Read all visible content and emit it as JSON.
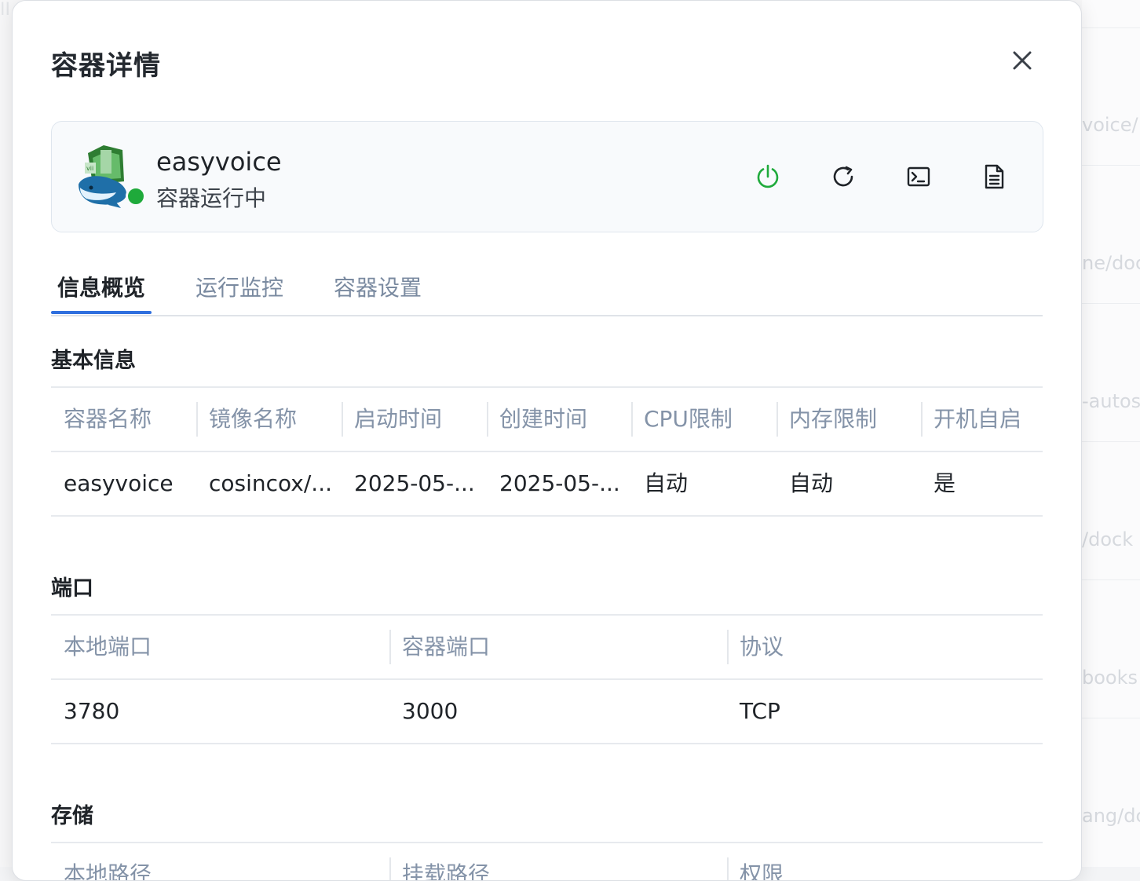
{
  "background": {
    "fragments": [
      "voice/",
      "ne/doc",
      "-autos",
      "/dock",
      "books",
      "ang/dc"
    ],
    "corner_text": "II"
  },
  "modal": {
    "title": "容器详情",
    "close_icon": "close-icon"
  },
  "container": {
    "name": "easyvoice",
    "status": "容器运行中",
    "status_color": "#1faa3b",
    "actions": [
      {
        "name": "power-icon",
        "color": "#1faa3b"
      },
      {
        "name": "restart-icon",
        "color": "#1f2328"
      },
      {
        "name": "terminal-icon",
        "color": "#1f2328"
      },
      {
        "name": "log-icon",
        "color": "#1f2328"
      }
    ]
  },
  "tabs": [
    {
      "label": "信息概览",
      "active": true
    },
    {
      "label": "运行监控",
      "active": false
    },
    {
      "label": "容器设置",
      "active": false
    }
  ],
  "basic_info": {
    "title": "基本信息",
    "columns": [
      "容器名称",
      "镜像名称",
      "启动时间",
      "创建时间",
      "CPU限制",
      "内存限制",
      "开机自启"
    ],
    "row": [
      "easyvoice",
      "cosincox/...",
      "2025-05-...",
      "2025-05-...",
      "自动",
      "自动",
      "是"
    ]
  },
  "ports": {
    "title": "端口",
    "columns": [
      "本地端口",
      "容器端口",
      "协议"
    ],
    "rows": [
      [
        "3780",
        "3000",
        "TCP"
      ]
    ]
  },
  "storage": {
    "title": "存储",
    "columns": [
      "本地路径",
      "挂载路径",
      "权限"
    ]
  },
  "accent_color": "#2f6fde"
}
